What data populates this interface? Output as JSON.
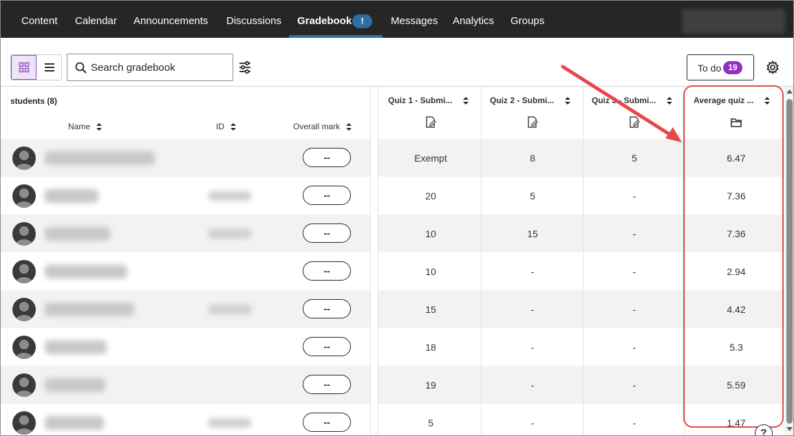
{
  "nav": {
    "tabs": [
      {
        "label": "Content"
      },
      {
        "label": "Calendar"
      },
      {
        "label": "Announcements"
      },
      {
        "label": "Discussions"
      },
      {
        "label": "Gradebook",
        "badge": "!",
        "active": true
      },
      {
        "label": "Messages"
      },
      {
        "label": "Analytics"
      },
      {
        "label": "Groups"
      }
    ]
  },
  "toolbar": {
    "search_placeholder": "Search gradebook",
    "todo_label": "To do",
    "todo_count": "19"
  },
  "table": {
    "students_label": "students (8)",
    "headers": {
      "name": "Name",
      "id": "ID",
      "overall": "Overall mark",
      "quiz1": "Quiz 1 - Submi...",
      "quiz2": "Quiz 2 - Submi...",
      "quiz3": "Quiz 3 - Submi...",
      "average": "Average quiz ..."
    },
    "rows": [
      {
        "overall": "--",
        "quiz1": "Exempt",
        "quiz2": "8",
        "quiz3": "5",
        "average": "6.47"
      },
      {
        "overall": "--",
        "quiz1": "20",
        "quiz2": "5",
        "quiz3": "-",
        "average": "7.36"
      },
      {
        "overall": "--",
        "quiz1": "10",
        "quiz2": "15",
        "quiz3": "-",
        "average": "7.36"
      },
      {
        "overall": "--",
        "quiz1": "10",
        "quiz2": "-",
        "quiz3": "-",
        "average": "2.94"
      },
      {
        "overall": "--",
        "quiz1": "15",
        "quiz2": "-",
        "quiz3": "-",
        "average": "4.42"
      },
      {
        "overall": "--",
        "quiz1": "18",
        "quiz2": "-",
        "quiz3": "-",
        "average": "5.3"
      },
      {
        "overall": "--",
        "quiz1": "19",
        "quiz2": "-",
        "quiz3": "-",
        "average": "5.59"
      },
      {
        "overall": "--",
        "quiz1": "5",
        "quiz2": "-",
        "quiz3": "-",
        "average": "1.47"
      }
    ]
  },
  "colors": {
    "nav_bg": "#262626",
    "accent_blue": "#2f6ea5",
    "todo_badge": "#8f2ebf",
    "annotation_red": "#e8474a"
  },
  "icons": {
    "view_grid": "grid-icon",
    "view_list": "list-icon",
    "search": "search-icon",
    "filter": "filter-sliders-icon",
    "settings": "gear-icon",
    "quiz_column": "edit-document-icon",
    "average_column": "folder-icon",
    "help": "help-icon"
  }
}
